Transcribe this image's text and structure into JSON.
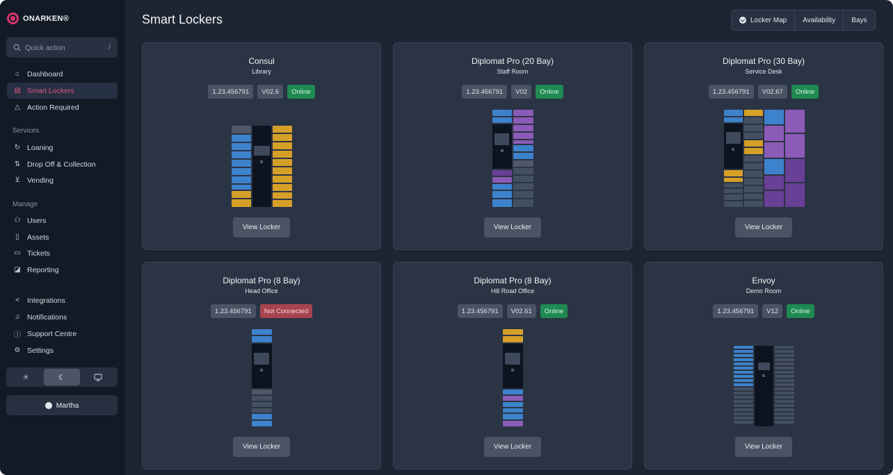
{
  "app": {
    "brand": "ONARKEN®"
  },
  "search": {
    "placeholder": "Quick action",
    "shortcut": "/"
  },
  "nav": {
    "top": [
      {
        "label": "Dashboard",
        "icon": "home-icon"
      },
      {
        "label": "Smart Lockers",
        "icon": "locker-icon",
        "active": true
      },
      {
        "label": "Action Required",
        "icon": "warning-icon"
      }
    ],
    "services_heading": "Services",
    "services": [
      {
        "label": "Loaning",
        "icon": "refresh-icon"
      },
      {
        "label": "Drop Off & Collection",
        "icon": "swap-icon"
      },
      {
        "label": "Vending",
        "icon": "cart-icon"
      }
    ],
    "manage_heading": "Manage",
    "manage": [
      {
        "label": "Users",
        "icon": "users-icon"
      },
      {
        "label": "Assets",
        "icon": "asset-icon"
      },
      {
        "label": "Tickets",
        "icon": "ticket-icon"
      },
      {
        "label": "Reporting",
        "icon": "report-icon"
      }
    ],
    "bottom": [
      {
        "label": "Integrations",
        "icon": "share-icon"
      },
      {
        "label": "Notifications",
        "icon": "bell-icon"
      },
      {
        "label": "Support Centre",
        "icon": "help-icon"
      },
      {
        "label": "Settings",
        "icon": "gear-icon"
      }
    ]
  },
  "theme": {
    "options": [
      "light",
      "dark",
      "system"
    ],
    "selected": "dark"
  },
  "user": {
    "name": "Martha"
  },
  "page": {
    "title": "Smart Lockers"
  },
  "view_tabs": [
    "Locker Map",
    "Availability",
    "Bays"
  ],
  "colors": {
    "accent": "#e2557f",
    "online": "#1f8a52",
    "offline": "#a8444d",
    "bay_blue": "#3d82cc",
    "bay_yellow": "#d6a028",
    "bay_purple": "#8c5bb8"
  },
  "lockers": [
    {
      "name": "Consul",
      "location": "Library",
      "serial": "1.23.456791",
      "version": "V02.6",
      "status": "Online",
      "button": "View Locker"
    },
    {
      "name": "Diplomat Pro (20 Bay)",
      "location": "Staff Room",
      "serial": "1.23.456791",
      "version": "V02",
      "status": "Online",
      "button": "View Locker"
    },
    {
      "name": "Diplomat Pro (30 Bay)",
      "location": "Service Desk",
      "serial": "1.23.456791",
      "version": "V02.67",
      "status": "Online",
      "button": "View Locker"
    },
    {
      "name": "Diplomat Pro (8 Bay)",
      "location": "Head Office",
      "serial": "1.23.456791",
      "version": "",
      "status": "Not Connected",
      "button": "View Locker"
    },
    {
      "name": "Diplomat Pro (8 Bay)",
      "location": "Hill Road Office",
      "serial": "1.23.456791",
      "version": "V02.61",
      "status": "Online",
      "button": "View Locker"
    },
    {
      "name": "Envoy",
      "location": "Demo Room",
      "serial": "1.23.456791",
      "version": "V12",
      "status": "Online",
      "button": "View Locker"
    }
  ]
}
